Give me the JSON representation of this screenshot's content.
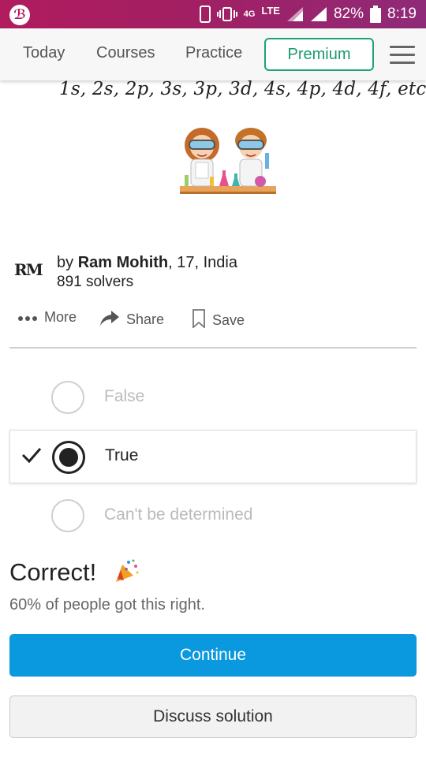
{
  "status_bar": {
    "network": "4G",
    "network_type": "LTE",
    "battery": "82%",
    "time": "8:19"
  },
  "nav": {
    "today": "Today",
    "courses": "Courses",
    "practice": "Practice",
    "premium": "Premium"
  },
  "problem": {
    "orbitals": "1s, 2s, 2p, 3s, 3p, 3d, 4s, 4p, 4d, 4f, etc"
  },
  "author": {
    "logo": "RM",
    "by": "by ",
    "name": "Ram Mohith",
    "details": ", 17, India",
    "solvers": "891 solvers"
  },
  "actions": {
    "more": "More",
    "share": "Share",
    "save": "Save"
  },
  "options": [
    {
      "label": "False",
      "selected": false
    },
    {
      "label": "True",
      "selected": true
    },
    {
      "label": "Can't be determined",
      "selected": false
    }
  ],
  "result": {
    "title": "Correct!",
    "stats": "60% of people got this right."
  },
  "buttons": {
    "continue": "Continue",
    "discuss": "Discuss solution"
  },
  "colors": {
    "status_bar": "#a21f63",
    "premium": "#1aa37a",
    "continue": "#0a98de"
  }
}
